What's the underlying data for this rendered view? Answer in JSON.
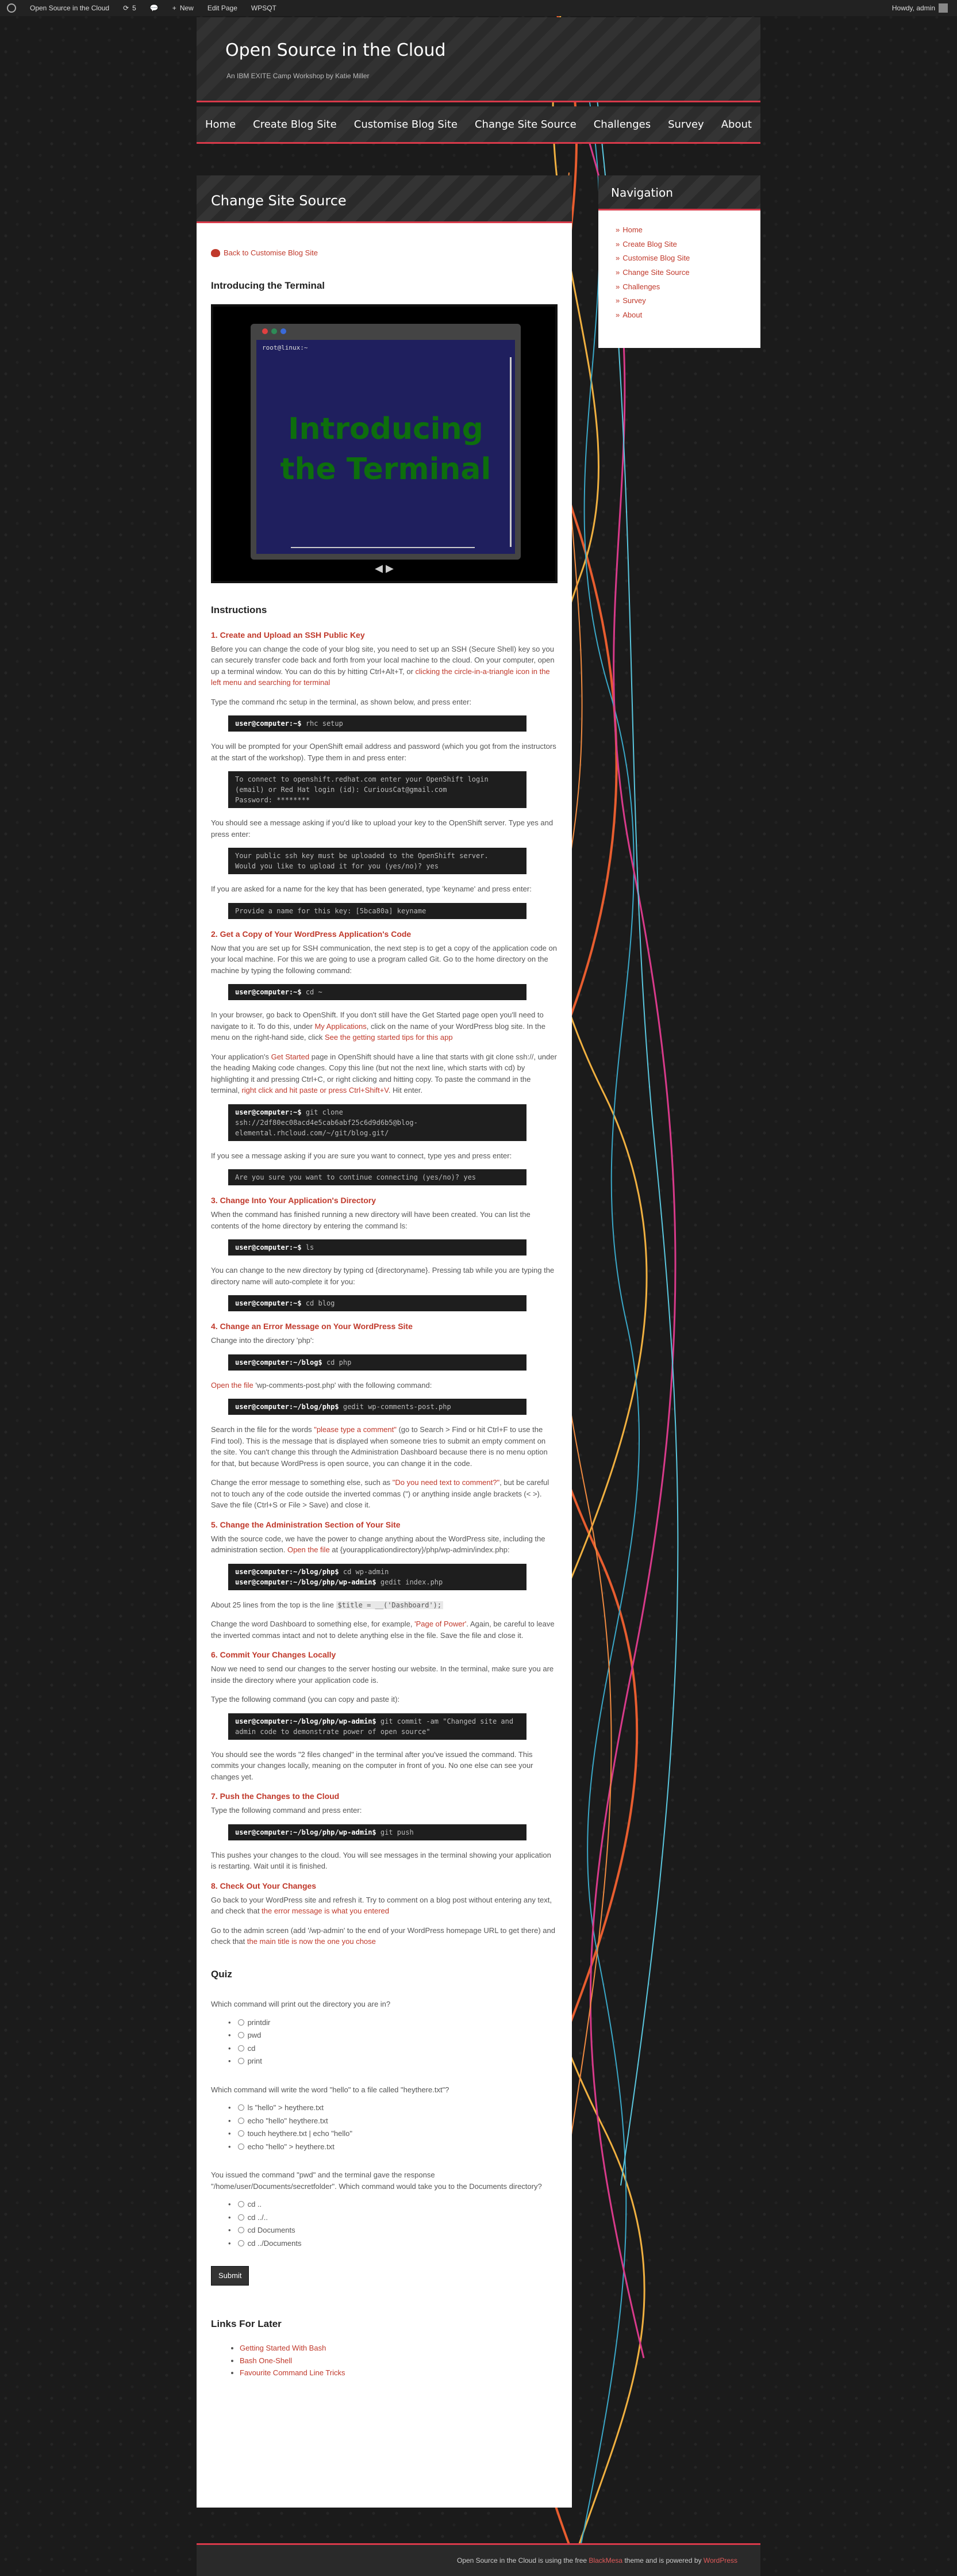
{
  "adminbar": {
    "site": "Open Source in the Cloud",
    "updates": "5",
    "new": "New",
    "edit": "Edit Page",
    "wpsqt": "WPSQT",
    "howdy": "Howdy, admin"
  },
  "header": {
    "title": "Open Source in the Cloud",
    "description": "An IBM EXITE Camp Workshop by Katie Miller"
  },
  "nav": [
    "Home",
    "Create Blog Site",
    "Customise Blog Site",
    "Change Site Source",
    "Challenges",
    "Survey",
    "About"
  ],
  "page": {
    "title": "Change Site Source",
    "back_link": "Back to Customise Blog Site",
    "intro_heading": "Introducing the Terminal",
    "slide_prompt": "root@linux:~",
    "slide_text": "Introducing the Terminal",
    "slide_nav": "◀ ▶",
    "instructions_heading": "Instructions"
  },
  "steps": [
    {
      "title": "1. Create and Upload an SSH Public Key",
      "p1": "Before you can change the code of your blog site, you need to set up an SSH (Secure Shell) key so you can securely transfer code back and forth from your local machine to the cloud. On your computer, open up a terminal window. You can do this by hitting Ctrl+Alt+T, or ",
      "p1_link": "clicking the circle-in-a-triangle icon in the left menu and searching for terminal",
      "p2": "Type the command rhc setup in the terminal, as shown below, and press enter:",
      "c1": "rhc setup",
      "p3": "You will be prompted for your OpenShift email address and password (which you got from the instructors at the start of the workshop). Type them in and press enter:",
      "c2": "To connect to openshift.redhat.com enter your OpenShift login (email) or Red Hat login (id): CuriousCat@gmail.com\nPassword: ********",
      "p4": "You should see a message asking if you'd like to upload your key to the OpenShift server. Type yes and press enter:",
      "c3": "Your public ssh key must be uploaded to the OpenShift server.\nWould you like to upload it for you (yes/no)? yes",
      "p5": "If you are asked for a name for the key that has been generated, type 'keyname' and press enter:",
      "c4": "Provide a name for this key: [5bca80a] keyname"
    },
    {
      "title": "2. Get a Copy of Your WordPress Application's Code",
      "p1": "Now that you are set up for SSH communication, the next step is to get a copy of the application code on your local machine. For this we are going to use a program called Git. Go to the home directory on the machine by typing the following command:",
      "c1": "cd ~",
      "p2": "In your browser, go back to OpenShift. If you don't still have the Get Started page open you'll need to navigate to it. To do this, under ",
      "p2_link": "My Applications",
      "p2b": ", click on the name of your WordPress blog site. In the menu on the right-hand side, click ",
      "p2_link2": "See the getting started tips for this app",
      "p3": "Your application's ",
      "p3_link": "Get Started",
      "p3b": " page in OpenShift should have a line that starts with git clone ssh://, under the heading Making code changes. Copy this line (but not the next line, which starts with cd) by highlighting it and pressing Ctrl+C, or right clicking and hitting copy. To paste the command in the terminal, ",
      "p3_link2": "right click and hit paste or press Ctrl+Shift+V",
      "p3c": ". Hit enter.",
      "c2": "git clone ssh://2df80ec08acd4e5cab6abf25c6d9d6b5@blog-elemental.rhcloud.com/~/git/blog.git/",
      "p4": "If you see a message asking if you are sure you want to connect, type yes and press enter:",
      "c3": "Are you sure you want to continue connecting (yes/no)? yes"
    },
    {
      "title": "3. Change Into Your Application's Directory",
      "p1": "When the command has finished running a new directory will have been created. You can list the contents of the home directory by entering the command ls:",
      "c1": "ls",
      "p2": "You can change to the new directory by typing cd {directoryname}. Pressing tab while you are typing the directory name will auto-complete it for you:",
      "c2": "cd blog"
    },
    {
      "title": "4. Change an Error Message on Your WordPress Site",
      "p1": "Change into the directory 'php':",
      "c1": "cd php",
      "p2_link": "Open the file",
      "p2": " 'wp-comments-post.php' with the following command:",
      "c2": "gedit wp-comments-post.php",
      "p3": "Search in the file for the words ",
      "p3_link": "\"please type a comment\"",
      "p3b": " (go to Search > Find or hit Ctrl+F to use the Find tool). This is the message that is displayed when someone tries to submit an empty comment on the site. You can't change this through the Administration Dashboard because there is no menu option for that, but because WordPress is open source, you can change it in the code.",
      "p4": "Change the error message to something else, such as ",
      "p4_link": "\"Do you need text to comment?\"",
      "p4b": ", but be careful not to touch any of the code outside the inverted commas (\") or anything inside angle brackets (< >). Save the file (Ctrl+S or File > Save) and close it."
    },
    {
      "title": "5. Change the Administration Section of Your Site",
      "p1": "With the source code, we have the power to change anything about the WordPress site, including the administration section. ",
      "p1_link": "Open the file",
      "p1b": " at {yourapplicationdirectory}/php/wp-admin/index.php:",
      "c1": "cd wp-admin",
      "c1b": "gedit index.php",
      "p2": "About 25 lines from the top is the line ",
      "p2_code": "$title = __('Dashboard');",
      "p3": "Change the word Dashboard to something else, for example, ",
      "p3_link": "'Page of Power'",
      "p3b": ". Again, be careful to leave the inverted commas intact and not to delete anything else in the file. Save the file and close it."
    },
    {
      "title": "6. Commit Your Changes Locally",
      "p1": "Now we need to send our changes to the server hosting our website. In the terminal, make sure you are inside the directory where your application code is.",
      "p2": "Type the following command (you can copy and paste it):",
      "c1": "git commit -am \"Changed site and admin code to demonstrate power of open source\"",
      "p3": "You should see the words \"2 files changed\" in the terminal after you've issued the command. This commits your changes locally, meaning on the computer in front of you. No one else can see your changes yet."
    },
    {
      "title": "7. Push the Changes to the Cloud",
      "p1": "Type the following command and press enter:",
      "c1": "git push",
      "p2": "This pushes your changes to the cloud. You will see messages in the terminal showing your application is restarting. Wait until it is finished."
    },
    {
      "title": "8. Check Out Your Changes",
      "p1": "Go back to your WordPress site and refresh it. Try to comment on a blog post without entering any text, and check that ",
      "p1_link": "the error message is what you entered",
      "p2": "Go to the admin screen (add '/wp-admin' to the end of your WordPress homepage URL to get there) and check that ",
      "p2_link": "the main title is now the one you chose"
    }
  ],
  "prompts": {
    "home": "user@computer:~$",
    "blog": "user@computer:~/blog$",
    "php": "user@computer:~/blog/php$",
    "admin": "user@computer:~/blog/php/wp-admin$"
  },
  "quiz": {
    "heading": "Quiz",
    "q1": "Which command will print out the directory you are in?",
    "q1_opts": [
      "printdir",
      "pwd",
      "cd",
      "print"
    ],
    "q2": "Which command will write the word \"hello\" to a file called \"heythere.txt\"?",
    "q2_opts": [
      "ls \"hello\" > heythere.txt",
      "echo \"hello\" heythere.txt",
      "touch heythere.txt | echo \"hello\"",
      "echo \"hello\" > heythere.txt"
    ],
    "q3": "You issued the command \"pwd\" and the terminal gave the response \"/home/user/Documents/secretfolder\". Which command would take you to the Documents directory?",
    "q3_opts": [
      "cd ..",
      "cd ../..",
      "cd Documents",
      "cd ../Documents"
    ],
    "submit": "Submit"
  },
  "links_later": {
    "heading": "Links For Later",
    "items": [
      "Getting Started With Bash",
      "Bash One-Shell",
      "Favourite Command Line Tricks"
    ]
  },
  "sidebar": {
    "heading": "Navigation",
    "items": [
      "Home",
      "Create Blog Site",
      "Customise Blog Site",
      "Change Site Source",
      "Challenges",
      "Survey",
      "About"
    ]
  },
  "footer": {
    "pre": "Open Source in the Cloud is using the free ",
    "theme": "BlackMesa",
    "mid": " theme and is powered by ",
    "wp": "WordPress"
  }
}
